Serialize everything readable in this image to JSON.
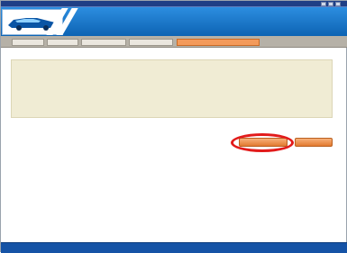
{
  "window": {
    "title_text": "",
    "buttons": [
      "minimize",
      "maximize",
      "close"
    ]
  },
  "header": {
    "title": "",
    "subtitle": ""
  },
  "tabs": [
    {
      "label": ""
    },
    {
      "label": ""
    },
    {
      "label": ""
    },
    {
      "label": ""
    },
    {
      "label": "",
      "active": true
    }
  ],
  "panel": {
    "lines": [
      "",
      "",
      ""
    ]
  },
  "buttons": {
    "primary_label": "",
    "secondary_label": ""
  },
  "footer": {
    "copyright": ""
  },
  "colors": {
    "header_blue": "#0f6fc3",
    "tab_active": "#f39a5a",
    "panel_bg": "#f0ecd4",
    "highlight_red": "#e21b1b",
    "footer_blue": "#1553a6"
  }
}
